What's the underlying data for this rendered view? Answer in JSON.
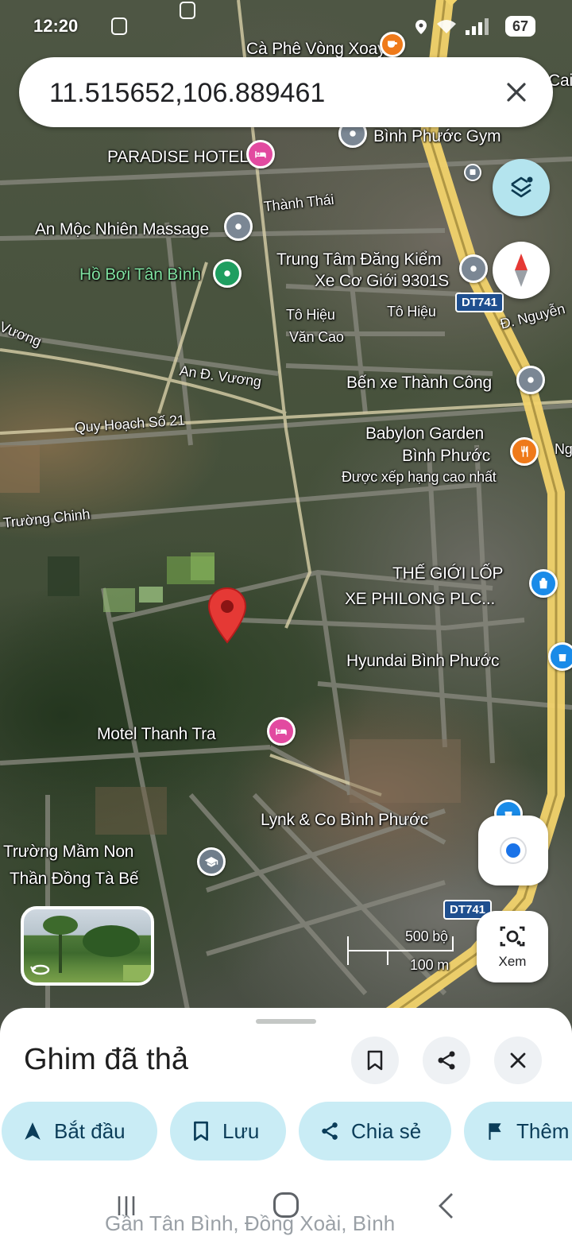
{
  "status_bar": {
    "time": "12:20",
    "battery": "67"
  },
  "search": {
    "query": "11.515652,106.889461"
  },
  "map": {
    "labels": {
      "ca_phe": "Cà Phê Vòng Xoay",
      "cai": "Cai",
      "binh_phuoc_gym": "Bình Phước Gym",
      "paradise": "PARADISE HOTEL",
      "thanh_thai": "Thành Thái",
      "an_moc": "An Mộc Nhiên Massage",
      "trung_tam_1": "Trung Tâm Đăng Kiểm",
      "trung_tam_2": "Xe Cơ Giới 9301S",
      "ho_boi": "Hồ Bơi Tân Bình",
      "dt741_top": "DT741",
      "vuong_left": "Vương",
      "to_hieu_1": "Tô Hiệu",
      "to_hieu_2": "Tô Hiệu",
      "van_cao": "Văn Cao",
      "d_nguyen": "Đ. Nguyễn",
      "an_d_vuong": "An Đ. Vương",
      "ben_xe": "Bến xe Thành Công",
      "quy_hoach": "Quy Hoạch Số 21",
      "babylon_1": "Babylon Garden",
      "babylon_2": "Bình Phước",
      "babylon_3": "Được xếp hạng cao nhất",
      "ng": "Ng",
      "truong_chinh": "Trường Chinh",
      "the_gioi_1": "THẾ GIỚI LỐP",
      "the_gioi_2": "XE PHILONG PLC...",
      "hyundai": "Hyundai Bình Phước",
      "motel": "Motel Thanh Tra",
      "lynk": "Lynk & Co Bình Phước",
      "mam_non_1": "Trường Mầm Non",
      "mam_non_2": "Thần Đồng Tà Bế",
      "dt741_bottom": "DT741"
    },
    "scale": {
      "top": "500 bộ",
      "bottom": "100 m"
    },
    "lens_label": "Xem"
  },
  "sheet": {
    "title": "Ghim đã thả",
    "chips": {
      "start": "Bắt đầu",
      "save": "Lưu",
      "share": "Chia sẻ",
      "more": "Thêm"
    },
    "address": "Gần Tân Bình, Đồng Xoài, Bình"
  },
  "colors": {
    "pin": "#e53935",
    "chip_bg": "#c9ecf5",
    "road": "#e8d68a",
    "highway": "#f2d36b"
  }
}
